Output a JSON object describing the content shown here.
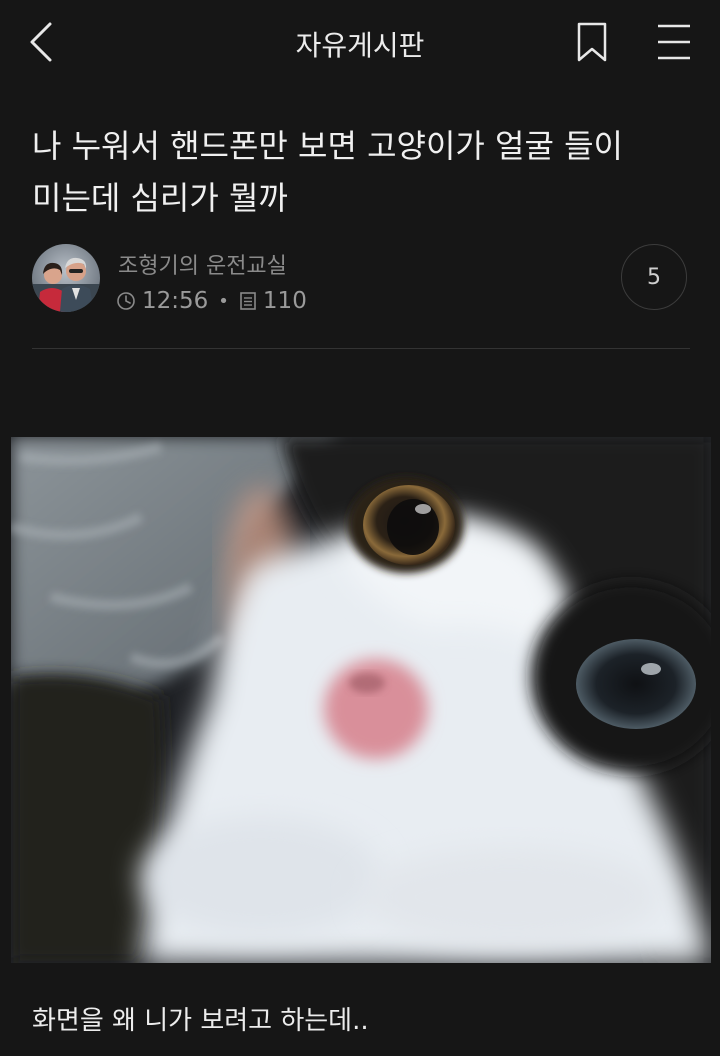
{
  "header": {
    "board_title": "자유게시판",
    "back_icon": "chevron-left-icon",
    "bookmark_icon": "bookmark-icon",
    "menu_icon": "hamburger-menu-icon"
  },
  "post": {
    "title_line1": "나 누워서 핸드폰만 보면 고양이가 얼굴 들이",
    "title_line2": "미는데 심리가 뭘까",
    "author": "조형기의 운전교실",
    "time": "12:56",
    "views": "110",
    "comment_count": "5",
    "body": "화면을 왜 니가 보려고 하는데.."
  },
  "colors": {
    "background": "#161616",
    "text": "#f0f0f0",
    "muted": "#8a8a8a",
    "divider": "#333333"
  }
}
